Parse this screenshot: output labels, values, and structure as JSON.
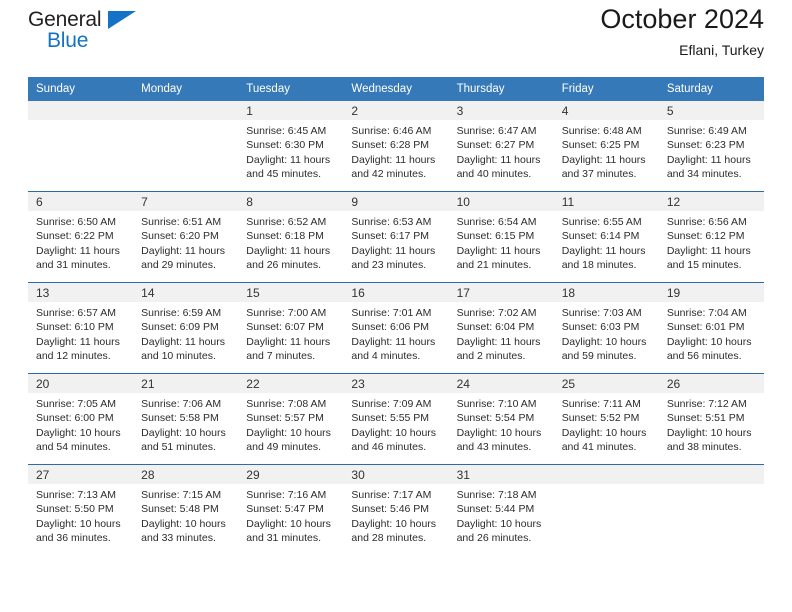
{
  "brand": {
    "name_dark": "General",
    "name_blue": "Blue",
    "accent_color": "#1473c6"
  },
  "header": {
    "title": "October 2024",
    "subtitle": "Eflani, Turkey"
  },
  "calendar": {
    "header_bg": "#3679b8",
    "daynum_bg": "#f1f1f1",
    "row_separator_color": "#2b6ca8",
    "weekday_headers": [
      "Sunday",
      "Monday",
      "Tuesday",
      "Wednesday",
      "Thursday",
      "Friday",
      "Saturday"
    ],
    "labels": {
      "sunrise": "Sunrise:",
      "sunset": "Sunset:",
      "daylight": "Daylight:"
    },
    "weeks": [
      [
        {
          "day": "",
          "empty": true
        },
        {
          "day": "",
          "empty": true
        },
        {
          "day": "1",
          "sunrise": "Sunrise: 6:45 AM",
          "sunset": "Sunset: 6:30 PM",
          "daylight1": "Daylight: 11 hours",
          "daylight2": "and 45 minutes."
        },
        {
          "day": "2",
          "sunrise": "Sunrise: 6:46 AM",
          "sunset": "Sunset: 6:28 PM",
          "daylight1": "Daylight: 11 hours",
          "daylight2": "and 42 minutes."
        },
        {
          "day": "3",
          "sunrise": "Sunrise: 6:47 AM",
          "sunset": "Sunset: 6:27 PM",
          "daylight1": "Daylight: 11 hours",
          "daylight2": "and 40 minutes."
        },
        {
          "day": "4",
          "sunrise": "Sunrise: 6:48 AM",
          "sunset": "Sunset: 6:25 PM",
          "daylight1": "Daylight: 11 hours",
          "daylight2": "and 37 minutes."
        },
        {
          "day": "5",
          "sunrise": "Sunrise: 6:49 AM",
          "sunset": "Sunset: 6:23 PM",
          "daylight1": "Daylight: 11 hours",
          "daylight2": "and 34 minutes."
        }
      ],
      [
        {
          "day": "6",
          "sunrise": "Sunrise: 6:50 AM",
          "sunset": "Sunset: 6:22 PM",
          "daylight1": "Daylight: 11 hours",
          "daylight2": "and 31 minutes."
        },
        {
          "day": "7",
          "sunrise": "Sunrise: 6:51 AM",
          "sunset": "Sunset: 6:20 PM",
          "daylight1": "Daylight: 11 hours",
          "daylight2": "and 29 minutes."
        },
        {
          "day": "8",
          "sunrise": "Sunrise: 6:52 AM",
          "sunset": "Sunset: 6:18 PM",
          "daylight1": "Daylight: 11 hours",
          "daylight2": "and 26 minutes."
        },
        {
          "day": "9",
          "sunrise": "Sunrise: 6:53 AM",
          "sunset": "Sunset: 6:17 PM",
          "daylight1": "Daylight: 11 hours",
          "daylight2": "and 23 minutes."
        },
        {
          "day": "10",
          "sunrise": "Sunrise: 6:54 AM",
          "sunset": "Sunset: 6:15 PM",
          "daylight1": "Daylight: 11 hours",
          "daylight2": "and 21 minutes."
        },
        {
          "day": "11",
          "sunrise": "Sunrise: 6:55 AM",
          "sunset": "Sunset: 6:14 PM",
          "daylight1": "Daylight: 11 hours",
          "daylight2": "and 18 minutes."
        },
        {
          "day": "12",
          "sunrise": "Sunrise: 6:56 AM",
          "sunset": "Sunset: 6:12 PM",
          "daylight1": "Daylight: 11 hours",
          "daylight2": "and 15 minutes."
        }
      ],
      [
        {
          "day": "13",
          "sunrise": "Sunrise: 6:57 AM",
          "sunset": "Sunset: 6:10 PM",
          "daylight1": "Daylight: 11 hours",
          "daylight2": "and 12 minutes."
        },
        {
          "day": "14",
          "sunrise": "Sunrise: 6:59 AM",
          "sunset": "Sunset: 6:09 PM",
          "daylight1": "Daylight: 11 hours",
          "daylight2": "and 10 minutes."
        },
        {
          "day": "15",
          "sunrise": "Sunrise: 7:00 AM",
          "sunset": "Sunset: 6:07 PM",
          "daylight1": "Daylight: 11 hours",
          "daylight2": "and 7 minutes."
        },
        {
          "day": "16",
          "sunrise": "Sunrise: 7:01 AM",
          "sunset": "Sunset: 6:06 PM",
          "daylight1": "Daylight: 11 hours",
          "daylight2": "and 4 minutes."
        },
        {
          "day": "17",
          "sunrise": "Sunrise: 7:02 AM",
          "sunset": "Sunset: 6:04 PM",
          "daylight1": "Daylight: 11 hours",
          "daylight2": "and 2 minutes."
        },
        {
          "day": "18",
          "sunrise": "Sunrise: 7:03 AM",
          "sunset": "Sunset: 6:03 PM",
          "daylight1": "Daylight: 10 hours",
          "daylight2": "and 59 minutes."
        },
        {
          "day": "19",
          "sunrise": "Sunrise: 7:04 AM",
          "sunset": "Sunset: 6:01 PM",
          "daylight1": "Daylight: 10 hours",
          "daylight2": "and 56 minutes."
        }
      ],
      [
        {
          "day": "20",
          "sunrise": "Sunrise: 7:05 AM",
          "sunset": "Sunset: 6:00 PM",
          "daylight1": "Daylight: 10 hours",
          "daylight2": "and 54 minutes."
        },
        {
          "day": "21",
          "sunrise": "Sunrise: 7:06 AM",
          "sunset": "Sunset: 5:58 PM",
          "daylight1": "Daylight: 10 hours",
          "daylight2": "and 51 minutes."
        },
        {
          "day": "22",
          "sunrise": "Sunrise: 7:08 AM",
          "sunset": "Sunset: 5:57 PM",
          "daylight1": "Daylight: 10 hours",
          "daylight2": "and 49 minutes."
        },
        {
          "day": "23",
          "sunrise": "Sunrise: 7:09 AM",
          "sunset": "Sunset: 5:55 PM",
          "daylight1": "Daylight: 10 hours",
          "daylight2": "and 46 minutes."
        },
        {
          "day": "24",
          "sunrise": "Sunrise: 7:10 AM",
          "sunset": "Sunset: 5:54 PM",
          "daylight1": "Daylight: 10 hours",
          "daylight2": "and 43 minutes."
        },
        {
          "day": "25",
          "sunrise": "Sunrise: 7:11 AM",
          "sunset": "Sunset: 5:52 PM",
          "daylight1": "Daylight: 10 hours",
          "daylight2": "and 41 minutes."
        },
        {
          "day": "26",
          "sunrise": "Sunrise: 7:12 AM",
          "sunset": "Sunset: 5:51 PM",
          "daylight1": "Daylight: 10 hours",
          "daylight2": "and 38 minutes."
        }
      ],
      [
        {
          "day": "27",
          "sunrise": "Sunrise: 7:13 AM",
          "sunset": "Sunset: 5:50 PM",
          "daylight1": "Daylight: 10 hours",
          "daylight2": "and 36 minutes."
        },
        {
          "day": "28",
          "sunrise": "Sunrise: 7:15 AM",
          "sunset": "Sunset: 5:48 PM",
          "daylight1": "Daylight: 10 hours",
          "daylight2": "and 33 minutes."
        },
        {
          "day": "29",
          "sunrise": "Sunrise: 7:16 AM",
          "sunset": "Sunset: 5:47 PM",
          "daylight1": "Daylight: 10 hours",
          "daylight2": "and 31 minutes."
        },
        {
          "day": "30",
          "sunrise": "Sunrise: 7:17 AM",
          "sunset": "Sunset: 5:46 PM",
          "daylight1": "Daylight: 10 hours",
          "daylight2": "and 28 minutes."
        },
        {
          "day": "31",
          "sunrise": "Sunrise: 7:18 AM",
          "sunset": "Sunset: 5:44 PM",
          "daylight1": "Daylight: 10 hours",
          "daylight2": "and 26 minutes."
        },
        {
          "day": "",
          "empty": true
        },
        {
          "day": "",
          "empty": true
        }
      ]
    ]
  }
}
